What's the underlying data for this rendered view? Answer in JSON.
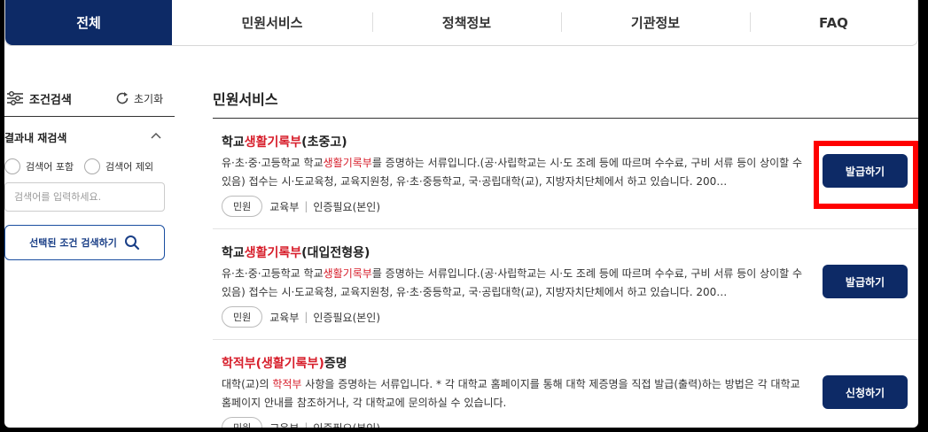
{
  "tabs": [
    {
      "label": "전체",
      "active": true
    },
    {
      "label": "민원서비스",
      "active": false
    },
    {
      "label": "정책정보",
      "active": false
    },
    {
      "label": "기관정보",
      "active": false
    },
    {
      "label": "FAQ",
      "active": false
    }
  ],
  "sidebar": {
    "title": "조건검색",
    "filter_icon": "sliders-icon",
    "reset_label": "초기화",
    "reset_icon": "refresh-icon",
    "refine_title": "결과내 재검색",
    "radio_include": "검색어 포함",
    "radio_exclude": "검색어 제외",
    "search_placeholder": "검색어를 입력하세요.",
    "search_button": "선택된 조건 검색하기"
  },
  "main": {
    "section_title": "민원서비스",
    "items": [
      {
        "title_pre": "학교",
        "title_hl": "생활기록부",
        "title_post": "(초중고)",
        "desc_pre": "유·초·중·고등학교 학교",
        "desc_hl": "생활기록부",
        "desc_post": "를 증명하는 서류입니다.(공·사립학교는 시·도 조례 등에 따르며 수수료, 구비 서류 등이 상이할 수 있음) 접수는 시·도교육청, 교육지원청, 유·초·중등학교, 국·공립대학(교), 지방자치단체에서 하고 있습니다. 200…",
        "tag": "민원",
        "org": "교육부",
        "auth": "인증필요(본인)",
        "button": "발급하기"
      },
      {
        "title_pre": "학교",
        "title_hl": "생활기록부",
        "title_post": "(대입전형용)",
        "desc_pre": "유·초·중·고등학교 학교",
        "desc_hl": "생활기록부",
        "desc_post": "를 증명하는 서류입니다.(공·사립학교는 시·도 조례 등에 따르며 수수료, 구비 서류 등이 상이할 수 있음) 접수는 시·도교육청, 교육지원청, 유·초·중등학교, 국·공립대학(교), 지방자치단체에서 하고 있습니다. 200…",
        "tag": "민원",
        "org": "교육부",
        "auth": "인증필요(본인)",
        "button": "발급하기"
      },
      {
        "title_pre": "",
        "title_hl": "학적부(생활기록부)",
        "title_post": "증명",
        "desc_pre": "대학(교)의 ",
        "desc_hl": "학적부",
        "desc_post": " 사항을 증명하는 서류입니다. * 각 대학교 홈페이지를 통해 대학 제증명을 직접 발급(출력)하는 방법은 각 대학교 홈페이지 안내를 참조하거나, 각 대학교에 문의하실 수 있습니다.",
        "tag": "민원",
        "org": "교육부",
        "auth": "인증필요(본인)",
        "button": "신청하기"
      }
    ]
  },
  "colors": {
    "primary": "#0d2a66",
    "highlight": "#d71e2b",
    "annotation": "#ff0000"
  }
}
